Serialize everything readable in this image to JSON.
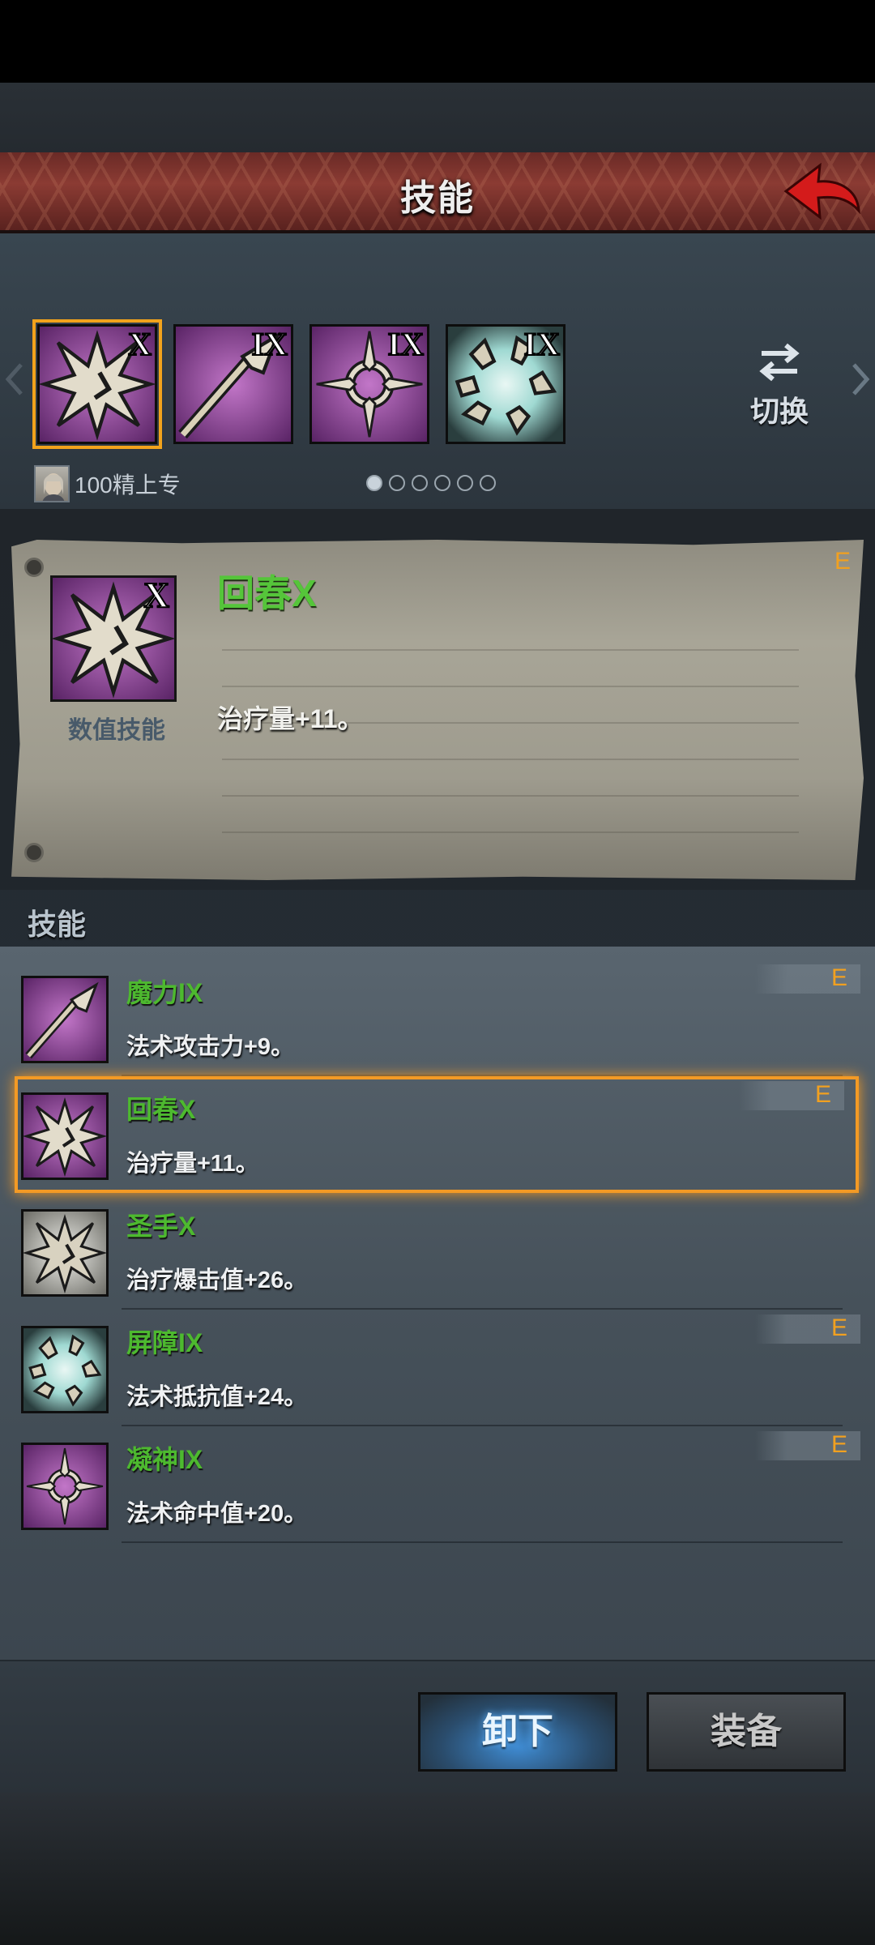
{
  "header": {
    "title": "技能"
  },
  "skill_bar": {
    "slots": [
      {
        "icon": "burst-icon",
        "level": "X",
        "selected": true
      },
      {
        "icon": "spear-icon",
        "level": "IX"
      },
      {
        "icon": "crosshair-icon",
        "level": "IX"
      },
      {
        "icon": "shatter-icon",
        "level": "IX"
      }
    ],
    "switch_label": "切换",
    "elite_label": "100精上专",
    "page_count": 6,
    "page_active": 0
  },
  "detail": {
    "name": "回春X",
    "level": "X",
    "type": "数值技能",
    "description": "治疗量+11。",
    "grade": "E"
  },
  "list": {
    "title": "技能",
    "items": [
      {
        "name": "魔力IX",
        "desc": "法术攻击力+9。",
        "grade": "E",
        "icon": "spear-icon"
      },
      {
        "name": "回春X",
        "desc": "治疗量+11。",
        "grade": "E",
        "icon": "burst-icon",
        "selected": true
      },
      {
        "name": "圣手X",
        "desc": "治疗爆击值+26。",
        "grade": "",
        "icon": "burst-light-icon"
      },
      {
        "name": "屏障IX",
        "desc": "法术抵抗值+24。",
        "grade": "E",
        "icon": "shatter-icon"
      },
      {
        "name": "凝神IX",
        "desc": "法术命中值+20。",
        "grade": "E",
        "icon": "crosshair-icon"
      }
    ]
  },
  "buttons": {
    "unequip": "卸下",
    "equip": "装备"
  },
  "colors": {
    "skill_name": "#4db92f",
    "grade": "#f1a020",
    "selection": "#f39a25"
  }
}
